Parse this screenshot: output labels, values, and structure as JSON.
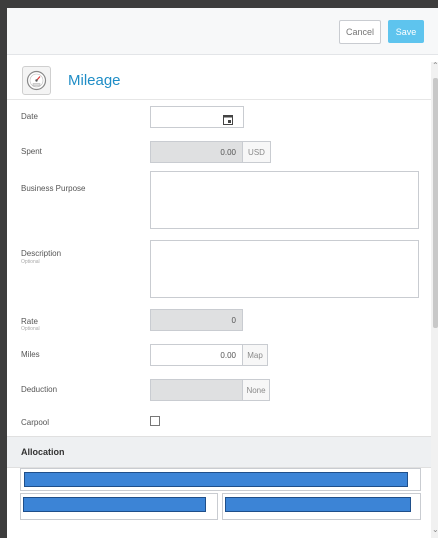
{
  "header": {
    "cancel_label": "Cancel",
    "save_label": "Save"
  },
  "title": {
    "icon": "odometer-icon",
    "text": "Mileage"
  },
  "fields": {
    "date": {
      "label": "Date",
      "icon": "calendar-icon",
      "value": ""
    },
    "spent": {
      "label": "Spent",
      "value": "0.00",
      "currency": "USD"
    },
    "business_purpose": {
      "label": "Business Purpose",
      "value": ""
    },
    "description": {
      "label": "Description",
      "sublabel": "Optional",
      "value": ""
    },
    "rate": {
      "label": "Rate",
      "sublabel": "Optional",
      "value": "0"
    },
    "miles": {
      "label": "Miles",
      "value": "0.00",
      "map_label": "Map"
    },
    "deduction": {
      "label": "Deduction",
      "value": "",
      "option_label": "None"
    },
    "carpool": {
      "label": "Carpool",
      "checked": false
    }
  },
  "allocation": {
    "title": "Allocation"
  },
  "colors": {
    "accent": "#1f8dc6",
    "save_button": "#5ec4ee",
    "redaction": "#3c84d6"
  }
}
